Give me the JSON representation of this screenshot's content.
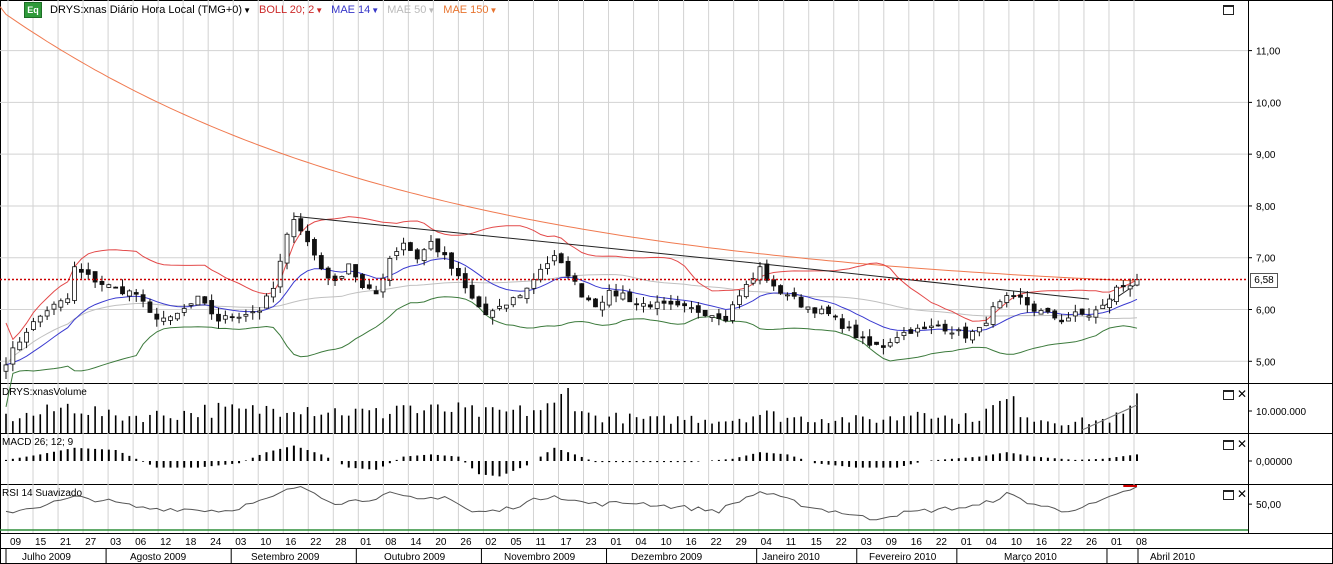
{
  "header": {
    "symbol_title": "DRYS:xnas Diário Hora Local (TMG+0)",
    "icon_label": "Eq",
    "indicators": [
      {
        "label": "BOLL 20; 2",
        "color": "#cc2b2b"
      },
      {
        "label": "MAE 14",
        "color": "#3636c8"
      },
      {
        "label": "MAE 50",
        "color": "#bbbbbb"
      },
      {
        "label": "MAE 150",
        "color": "#e8742f"
      }
    ]
  },
  "panes": {
    "volume_label": "DRYS:xnasVolume",
    "macd_label": "MACD 26; 12; 9",
    "rsi_label": "RSI 14 Suavizado"
  },
  "last_price_label": "6,58",
  "colors": {
    "candle": "#111111",
    "boll_upper": "#e34a4a",
    "boll_lower": "#3c7a3c",
    "mae14": "#3b3bd0",
    "mae50": "#c0c0c0",
    "mae150": "#f07a50",
    "last_price": "#cc0000",
    "trendline": "#222222",
    "grid": "#d2d2d2"
  },
  "chart_data": {
    "type": "candlestick",
    "title": "DRYS:xnas Diário Hora Local (TMG+0)",
    "price_axis": {
      "ticks": [
        "5,00",
        "6,00",
        "7,00",
        "8,00",
        "9,00",
        "10,00",
        "11,00"
      ],
      "ylim": [
        4.6,
        11.9
      ]
    },
    "volume_axis": {
      "ticks": [
        "10.000.000"
      ]
    },
    "macd_axis": {
      "ticks": [
        "0,00000"
      ]
    },
    "rsi_axis": {
      "ticks": [
        "50,00"
      ]
    },
    "last_price": 6.58,
    "x_day_ticks": [
      "09",
      "15",
      "21",
      "27",
      "03",
      "06",
      "12",
      "18",
      "24",
      "03",
      "10",
      "16",
      "22",
      "28",
      "01",
      "08",
      "14",
      "20",
      "26",
      "02",
      "05",
      "11",
      "17",
      "23",
      "01",
      "04",
      "10",
      "16",
      "22",
      "29",
      "04",
      "11",
      "15",
      "22",
      "03",
      "09",
      "16",
      "22",
      "01",
      "04",
      "10",
      "16",
      "22",
      "26",
      "01",
      "08"
    ],
    "x_month_labels": [
      "Julho 2009",
      "Agosto 2009",
      "Setembro 2009",
      "Outubro 2009",
      "Novembro 2009",
      "Dezembro 2009",
      "Janeiro 2010",
      "Fevereiro 2010",
      "Março 2010",
      "Abril 2010"
    ],
    "close_keypoints": [
      [
        0,
        5.0
      ],
      [
        3,
        5.6
      ],
      [
        6,
        6.0
      ],
      [
        9,
        6.2
      ],
      [
        10,
        6.8
      ],
      [
        11,
        6.7
      ],
      [
        14,
        6.5
      ],
      [
        16,
        6.4
      ],
      [
        19,
        6.3
      ],
      [
        21,
        5.9
      ],
      [
        24,
        5.8
      ],
      [
        28,
        6.2
      ],
      [
        31,
        5.8
      ],
      [
        34,
        5.9
      ],
      [
        37,
        6.0
      ],
      [
        39,
        6.4
      ],
      [
        41,
        7.4
      ],
      [
        42,
        7.8
      ],
      [
        44,
        7.3
      ],
      [
        46,
        6.8
      ],
      [
        48,
        6.5
      ],
      [
        50,
        6.9
      ],
      [
        52,
        6.4
      ],
      [
        54,
        6.3
      ],
      [
        56,
        7.0
      ],
      [
        58,
        7.3
      ],
      [
        60,
        7.0
      ],
      [
        62,
        7.3
      ],
      [
        64,
        7.0
      ],
      [
        66,
        6.6
      ],
      [
        68,
        6.2
      ],
      [
        70,
        5.9
      ],
      [
        72,
        6.0
      ],
      [
        74,
        6.2
      ],
      [
        76,
        6.4
      ],
      [
        78,
        6.8
      ],
      [
        80,
        7.0
      ],
      [
        82,
        6.7
      ],
      [
        84,
        6.3
      ],
      [
        86,
        6.1
      ],
      [
        88,
        6.3
      ],
      [
        90,
        6.3
      ],
      [
        92,
        6.1
      ],
      [
        94,
        6.1
      ],
      [
        97,
        6.05
      ],
      [
        100,
        6.0
      ],
      [
        102,
        5.95
      ],
      [
        105,
        5.85
      ],
      [
        107,
        6.3
      ],
      [
        109,
        6.6
      ],
      [
        110,
        6.8
      ],
      [
        112,
        6.4
      ],
      [
        114,
        6.3
      ],
      [
        116,
        6.1
      ],
      [
        118,
        6.0
      ],
      [
        120,
        5.9
      ],
      [
        122,
        5.7
      ],
      [
        124,
        5.5
      ],
      [
        126,
        5.3
      ],
      [
        128,
        5.3
      ],
      [
        130,
        5.5
      ],
      [
        132,
        5.6
      ],
      [
        134,
        5.6
      ],
      [
        136,
        5.7
      ],
      [
        138,
        5.6
      ],
      [
        140,
        5.5
      ],
      [
        142,
        5.6
      ],
      [
        144,
        6.0
      ],
      [
        146,
        6.2
      ],
      [
        148,
        6.2
      ],
      [
        150,
        6.0
      ],
      [
        152,
        5.9
      ],
      [
        154,
        5.8
      ],
      [
        156,
        5.9
      ],
      [
        158,
        5.9
      ],
      [
        160,
        6.05
      ],
      [
        162,
        6.4
      ],
      [
        164,
        6.5
      ],
      [
        165,
        6.58
      ]
    ],
    "volume_relative_keypoints": [
      [
        0,
        0.35
      ],
      [
        5,
        0.45
      ],
      [
        10,
        0.65
      ],
      [
        15,
        0.4
      ],
      [
        20,
        0.4
      ],
      [
        25,
        0.45
      ],
      [
        30,
        0.55
      ],
      [
        35,
        0.5
      ],
      [
        40,
        0.6
      ],
      [
        42,
        0.7
      ],
      [
        45,
        0.55
      ],
      [
        50,
        0.5
      ],
      [
        55,
        0.45
      ],
      [
        58,
        0.7
      ],
      [
        60,
        0.5
      ],
      [
        65,
        0.55
      ],
      [
        70,
        0.45
      ],
      [
        75,
        0.5
      ],
      [
        80,
        0.6
      ],
      [
        82,
        1.0
      ],
      [
        85,
        0.4
      ],
      [
        90,
        0.35
      ],
      [
        95,
        0.3
      ],
      [
        100,
        0.35
      ],
      [
        105,
        0.3
      ],
      [
        110,
        0.45
      ],
      [
        115,
        0.35
      ],
      [
        120,
        0.35
      ],
      [
        125,
        0.3
      ],
      [
        130,
        0.35
      ],
      [
        134,
        0.6
      ],
      [
        138,
        0.3
      ],
      [
        142,
        0.4
      ],
      [
        146,
        0.75
      ],
      [
        150,
        0.35
      ],
      [
        155,
        0.25
      ],
      [
        160,
        0.3
      ],
      [
        163,
        0.4
      ],
      [
        165,
        0.7
      ]
    ],
    "macd_keypoints": [
      [
        0,
        0.05
      ],
      [
        5,
        0.3
      ],
      [
        10,
        0.6
      ],
      [
        16,
        0.5
      ],
      [
        22,
        -0.3
      ],
      [
        28,
        -0.3
      ],
      [
        34,
        -0.1
      ],
      [
        38,
        0.4
      ],
      [
        42,
        0.7
      ],
      [
        46,
        0.3
      ],
      [
        50,
        -0.3
      ],
      [
        54,
        -0.4
      ],
      [
        58,
        0.2
      ],
      [
        62,
        0.3
      ],
      [
        66,
        0.2
      ],
      [
        69,
        -0.6
      ],
      [
        72,
        -0.7
      ],
      [
        76,
        -0.2
      ],
      [
        80,
        0.6
      ],
      [
        83,
        0.3
      ],
      [
        86,
        -0.05
      ],
      [
        92,
        -0.05
      ],
      [
        100,
        -0.05
      ],
      [
        106,
        0.1
      ],
      [
        110,
        0.4
      ],
      [
        114,
        0.3
      ],
      [
        118,
        -0.1
      ],
      [
        124,
        -0.3
      ],
      [
        130,
        -0.3
      ],
      [
        134,
        0.0
      ],
      [
        138,
        0.1
      ],
      [
        142,
        0.2
      ],
      [
        146,
        0.4
      ],
      [
        150,
        0.2
      ],
      [
        156,
        0.05
      ],
      [
        160,
        0.1
      ],
      [
        165,
        0.3
      ]
    ],
    "rsi_keypoints": [
      [
        0,
        40
      ],
      [
        5,
        48
      ],
      [
        10,
        58
      ],
      [
        14,
        55
      ],
      [
        20,
        45
      ],
      [
        26,
        44
      ],
      [
        32,
        42
      ],
      [
        38,
        55
      ],
      [
        42,
        70
      ],
      [
        44,
        68
      ],
      [
        48,
        52
      ],
      [
        52,
        55
      ],
      [
        56,
        62
      ],
      [
        60,
        55
      ],
      [
        64,
        60
      ],
      [
        68,
        40
      ],
      [
        72,
        42
      ],
      [
        76,
        52
      ],
      [
        80,
        62
      ],
      [
        82,
        55
      ],
      [
        86,
        50
      ],
      [
        92,
        52
      ],
      [
        96,
        48
      ],
      [
        100,
        45
      ],
      [
        104,
        42
      ],
      [
        108,
        58
      ],
      [
        110,
        65
      ],
      [
        114,
        55
      ],
      [
        118,
        45
      ],
      [
        122,
        40
      ],
      [
        126,
        32
      ],
      [
        130,
        38
      ],
      [
        134,
        42
      ],
      [
        138,
        45
      ],
      [
        142,
        48
      ],
      [
        144,
        55
      ],
      [
        146,
        62
      ],
      [
        150,
        50
      ],
      [
        154,
        42
      ],
      [
        158,
        48
      ],
      [
        162,
        60
      ],
      [
        164,
        68
      ],
      [
        165,
        70
      ]
    ]
  }
}
